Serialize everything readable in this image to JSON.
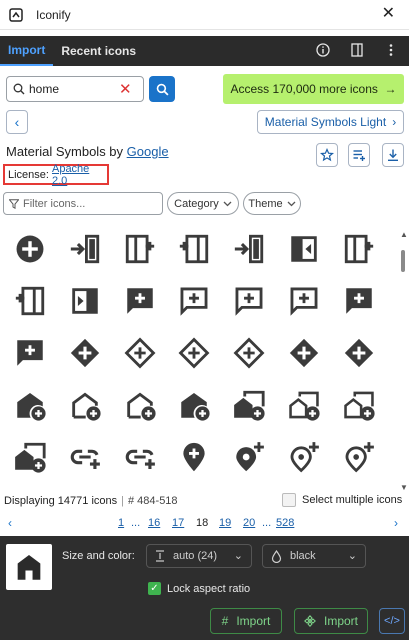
{
  "window": {
    "title": "Iconify",
    "close_icon": "close-icon"
  },
  "tabs": [
    {
      "label": "Import",
      "active": true
    },
    {
      "label": "Recent icons",
      "active": false
    }
  ],
  "tab_icons": [
    "info-icon",
    "panel-icon",
    "more-vertical-icon"
  ],
  "search": {
    "value": "home",
    "placeholder": ""
  },
  "promo": {
    "label": "Access 170,000 more icons",
    "arrow": "→"
  },
  "collection": {
    "button_label": "Material Symbols Light",
    "chevron": "›",
    "back": "‹"
  },
  "set": {
    "title_prefix": "Material Symbols by ",
    "author": "Google"
  },
  "license": {
    "prefix": "License:",
    "name": "Apache 2.0"
  },
  "filter": {
    "placeholder": "Filter icons..."
  },
  "dropdowns": {
    "category": "Category",
    "theme": "Theme"
  },
  "icons": [
    "add-circle",
    "move-item-right",
    "panel-add-right",
    "panel-add-left",
    "move-item-right",
    "panel-close-right",
    "panel-add-right",
    "panel-add-left",
    "panel-close-left",
    "add-comment",
    "add-comment-outline",
    "add-comment-outline",
    "add-comment-outline",
    "add-comment",
    "add-comment-filled",
    "add-diamond",
    "add-diamond-outline",
    "add-diamond-outline",
    "add-diamond-outline",
    "add-diamond",
    "add-diamond",
    "add-home",
    "add-home-outline",
    "add-home-outline",
    "add-home",
    "add-home-work",
    "add-home-work-outline",
    "add-home-work-outline",
    "add-home-work",
    "add-link",
    "add-link",
    "add-location",
    "add-location-alt",
    "add-location-alt-outline",
    "add-location-alt-outline"
  ],
  "status": {
    "displaying": "Displaying 14771 icons",
    "range": "# 484-518",
    "multi_label": "Select multiple icons"
  },
  "pager": {
    "prev": "‹",
    "next": "›",
    "pages": [
      "1",
      "...",
      "16",
      "17",
      "18",
      "19",
      "20",
      "...",
      "528"
    ],
    "current": "18"
  },
  "footer": {
    "size_label": "Size and color:",
    "size_value": "auto (24)",
    "color_value": "black",
    "lock_label": "Lock aspect ratio",
    "lock_checked": true,
    "import_svg_label": "Import",
    "import_component_label": "Import",
    "code_label": "</>"
  }
}
